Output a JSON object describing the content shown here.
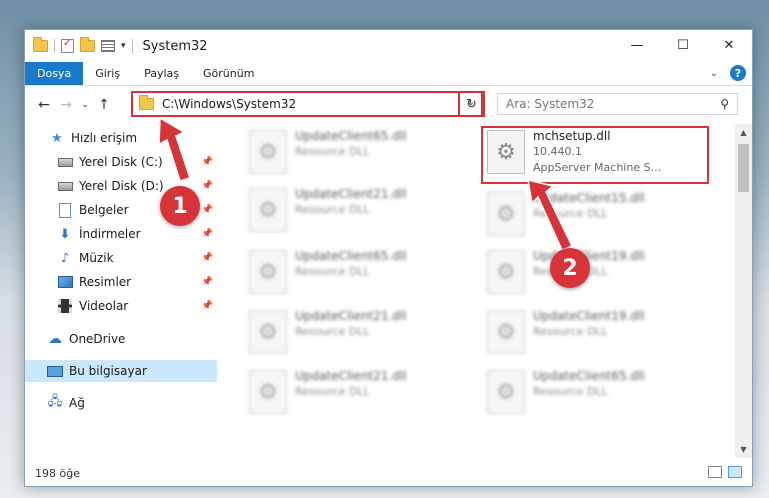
{
  "window": {
    "title": "System32"
  },
  "ribbon": {
    "tabs": [
      "Dosya",
      "Giriş",
      "Paylaş",
      "Görünüm"
    ]
  },
  "address": {
    "path": "C:\\Windows\\System32",
    "search_placeholder": "Ara: System32"
  },
  "sidebar": {
    "quick_access": "Hızlı erişim",
    "items": [
      {
        "label": "Yerel Disk (C:)",
        "icon": "drive-icon",
        "pinned": true
      },
      {
        "label": "Yerel Disk (D:)",
        "icon": "drive-icon",
        "pinned": true
      },
      {
        "label": "Belgeler",
        "icon": "documents-icon",
        "pinned": true
      },
      {
        "label": "İndirmeler",
        "icon": "downloads-icon",
        "pinned": true
      },
      {
        "label": "Müzik",
        "icon": "music-icon",
        "pinned": true
      },
      {
        "label": "Resimler",
        "icon": "pictures-icon",
        "pinned": true
      },
      {
        "label": "Videolar",
        "icon": "videos-icon",
        "pinned": true
      }
    ],
    "onedrive": "OneDrive",
    "this_pc": "Bu bilgisayar",
    "network": "Ağ"
  },
  "files": {
    "highlighted": {
      "name": "mchsetup.dll",
      "version": "10.440.1",
      "description": "AppServer Machine S..."
    },
    "others": [
      {
        "name": "UpdateClient65.dll",
        "sub": "Resource DLL"
      },
      {
        "name": "UpdateClient21.dll",
        "sub": "Resource DLL"
      },
      {
        "name": "UpdateClient15.dll",
        "sub": "Resource DLL"
      },
      {
        "name": "UpdateClient65.dll",
        "sub": "Resource DLL"
      },
      {
        "name": "UpdateClient19.dll",
        "sub": "Resource DLL"
      },
      {
        "name": "UpdateClient21.dll",
        "sub": "Resource DLL"
      },
      {
        "name": "UpdateClient19.dll",
        "sub": "Resource DLL"
      },
      {
        "name": "UpdateClient21.dll",
        "sub": "Resource DLL"
      },
      {
        "name": "UpdateClient65.dll",
        "sub": "Resource DLL"
      }
    ]
  },
  "status": {
    "count": "198 öğe"
  },
  "annotations": {
    "step1": "1",
    "step2": "2",
    "color": "#d9333a"
  }
}
